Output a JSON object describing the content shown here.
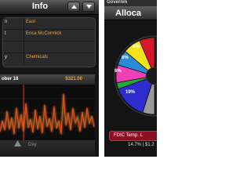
{
  "left_screen": {
    "header": {
      "title": "Info"
    },
    "fields": [
      {
        "key": "n",
        "value": "East"
      },
      {
        "key": "t",
        "value": "Erica McCormick"
      },
      {
        "key": "",
        "value": ""
      },
      {
        "key": "y",
        "value": "Chemicals"
      }
    ],
    "chart": {
      "date_label": "ober 18",
      "amount": "$321.00",
      "axis_label": "Day",
      "colors": {
        "line": "#e8521e",
        "glow": "#ff8a2a",
        "marker": "#e8a63a"
      }
    }
  },
  "right_screen": {
    "top_text": "Governm",
    "header": {
      "title": "Alloca"
    },
    "pie": {
      "labels": [
        "6%",
        "6%",
        "6%",
        "19%"
      ],
      "colors": [
        "#d7182a",
        "#f3e31d",
        "#2b8ad8",
        "#ef3fb5",
        "#27a93a",
        "#2c2ccf",
        "#9a9a9a"
      ]
    },
    "legend": {
      "label": "FDIC Temp. L"
    },
    "stat": {
      "text": "14.7% | $1.2"
    }
  }
}
